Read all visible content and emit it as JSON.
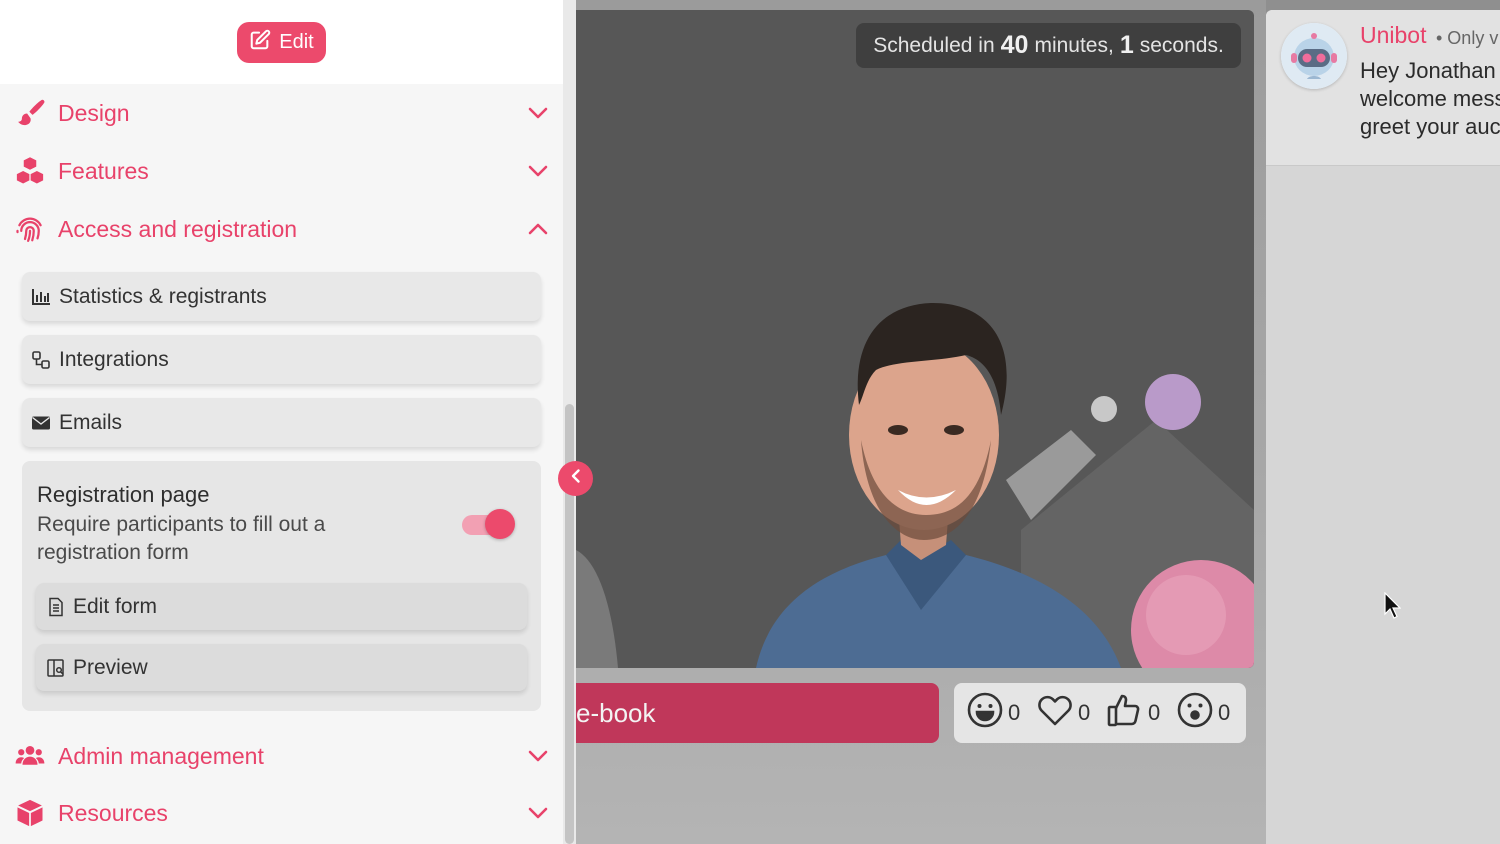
{
  "colors": {
    "accent": "#ec4a6c",
    "section_label": "#e8426a",
    "cta": "#c0375a",
    "stage_bg": "#575757"
  },
  "sidebar": {
    "edit_label": "Edit",
    "sections": [
      {
        "label": "Design",
        "icon": "paintbrush-icon",
        "expanded": false
      },
      {
        "label": "Features",
        "icon": "cubes-icon",
        "expanded": false
      },
      {
        "label": "Access and registration",
        "icon": "fingerprint-icon",
        "expanded": true
      },
      {
        "label": "Admin management",
        "icon": "users-icon",
        "expanded": false
      },
      {
        "label": "Resources",
        "icon": "box-icon",
        "expanded": false
      }
    ],
    "access_items": [
      {
        "label": "Statistics & registrants",
        "icon": "chart-bar-icon"
      },
      {
        "label": "Integrations",
        "icon": "integration-icon"
      },
      {
        "label": "Emails",
        "icon": "envelope-icon"
      }
    ],
    "registration": {
      "title": "Registration page",
      "description": "Require participants to fill out a registration form",
      "enabled": true,
      "edit_form_label": "Edit form",
      "preview_label": "Preview"
    }
  },
  "stage": {
    "scheduled_prefix": "Scheduled in",
    "minutes": "40",
    "minutes_label": "minutes,",
    "seconds": "1",
    "seconds_label": "seconds.",
    "cta_label": "e-book",
    "reactions": [
      {
        "icon": "smile-icon",
        "count": "0"
      },
      {
        "icon": "heart-icon",
        "count": "0"
      },
      {
        "icon": "thumbs-up-icon",
        "count": "0"
      },
      {
        "icon": "surprised-icon",
        "count": "0"
      }
    ]
  },
  "chat": {
    "bot_name": "Unibot",
    "visibility": "• Only v",
    "message_lines": [
      "Hey Jonathan",
      "welcome mess",
      "greet your auc"
    ]
  }
}
